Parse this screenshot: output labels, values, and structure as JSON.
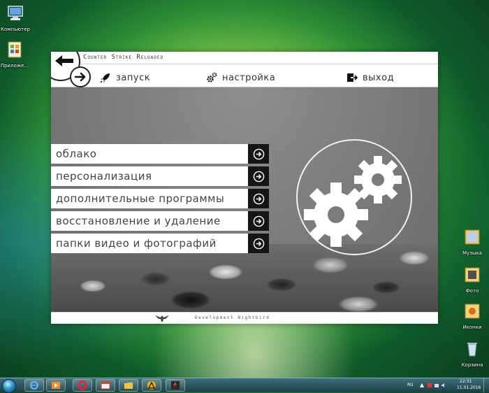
{
  "desktop": {
    "icons_left": [
      {
        "label": "Компьютер"
      },
      {
        "label": "Приложе..."
      }
    ],
    "icons_right": [
      {
        "label": "Музыка"
      },
      {
        "label": "Фото"
      },
      {
        "label": "Иконки"
      },
      {
        "label": "Корзина"
      }
    ]
  },
  "app": {
    "title": "Counter Strike Reloaded",
    "nav": {
      "launch": "запуск",
      "settings": "настройка",
      "exit": "выход"
    },
    "menu": [
      {
        "label": "облако"
      },
      {
        "label": "персонализация"
      },
      {
        "label": "дополнительные программы"
      },
      {
        "label": "восстановление и удаление"
      },
      {
        "label": "папки видео и фотографий"
      }
    ],
    "footer": "Development Nightbird"
  },
  "taskbar": {
    "lang": "RU",
    "time": "22:31",
    "date": "11.01.2016"
  },
  "colors": {
    "menu_button": "#151515",
    "window_gray": "#7b7b7b"
  }
}
